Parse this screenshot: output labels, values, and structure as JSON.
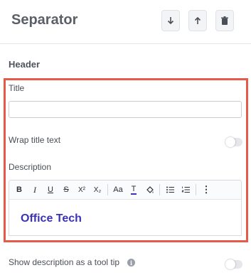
{
  "header": {
    "title": "Separator",
    "icons": [
      "move-down-icon",
      "move-up-icon",
      "trash-icon"
    ]
  },
  "section": {
    "title": "Header"
  },
  "fields": {
    "title_label": "Title",
    "title_value": "",
    "wrap_label": "Wrap title text",
    "wrap_on": false,
    "description_label": "Description",
    "description_text": "Office Tech",
    "tooltip_label": "Show description as a tool tip",
    "tooltip_on": false
  },
  "toolbar": {
    "bold": "B",
    "italic": "I",
    "underline": "U",
    "strike": "S",
    "superscript": "X²",
    "subscript": "X₂",
    "font_size": "Aa",
    "text_color": "T",
    "more": "⋮"
  },
  "colors": {
    "highlight_border": "#e55a48",
    "description_text": "#3b32b6",
    "text_color_underline": "#3b32b6"
  }
}
